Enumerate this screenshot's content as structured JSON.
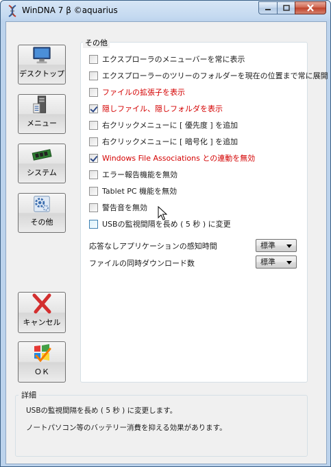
{
  "window": {
    "title": "WinDNA 7 β ©aquarius"
  },
  "nav": {
    "items": [
      {
        "label": "デスクトップ",
        "icon": "desktop-monitor-icon"
      },
      {
        "label": "メニュー",
        "icon": "menu-tower-icon"
      },
      {
        "label": "システム",
        "icon": "memory-chip-icon"
      },
      {
        "label": "その他",
        "icon": "gear-settings-icon"
      }
    ],
    "cancel_label": "キャンセル",
    "ok_label": "ＯＫ"
  },
  "group": {
    "title": "その他",
    "options": [
      {
        "label": "エクスプローラのメニューバーを常に表示",
        "checked": false,
        "highlight": false
      },
      {
        "label": "エクスプローラーのツリーのフォルダーを現在の位置まで常に展開",
        "checked": false,
        "highlight": false
      },
      {
        "label": "ファイルの拡張子を表示",
        "checked": false,
        "highlight": true
      },
      {
        "label": "隠しファイル、隠しフォルダを表示",
        "checked": true,
        "highlight": true
      },
      {
        "label": "右クリックメニューに [ 優先度 ] を追加",
        "checked": false,
        "highlight": false
      },
      {
        "label": "右クリックメニューに [ 暗号化 ] を追加",
        "checked": false,
        "highlight": false
      },
      {
        "label": "Windows File Associations との連動を無効",
        "checked": true,
        "highlight": true
      },
      {
        "label": "エラー報告機能を無効",
        "checked": false,
        "highlight": false
      },
      {
        "label": "Tablet PC 機能を無効",
        "checked": false,
        "highlight": false
      },
      {
        "label": "警告音を無効",
        "checked": false,
        "highlight": false
      },
      {
        "label": "USBの監視間隔を長め ( 5 秒 ) に変更",
        "checked": false,
        "highlight": false,
        "hover": true
      }
    ],
    "settings": [
      {
        "label": "応答なしアプリケーションの感知時間",
        "value": "標準"
      },
      {
        "label": "ファイルの同時ダウンロード数",
        "value": "標準"
      }
    ]
  },
  "detail": {
    "title": "詳細",
    "lines": [
      "USBの監視間隔を長め ( 5 秒 ) に変更します。",
      "ノートパソコン等のバッテリー消費を抑える効果があります。"
    ]
  },
  "colors": {
    "highlight_text": "#d40000",
    "window_frame": "#bcd3ec",
    "close_button": "#c0432b"
  }
}
